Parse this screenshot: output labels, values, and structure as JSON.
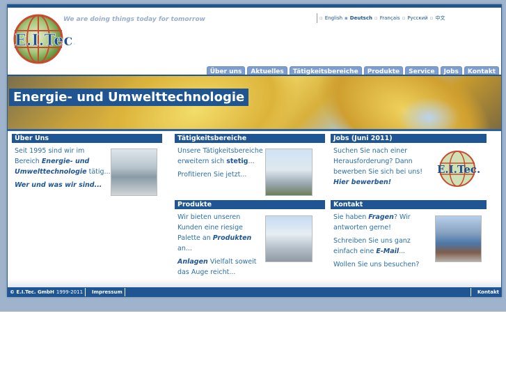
{
  "header": {
    "logo_text": "E.I.Tec.",
    "tagline": "We are doing things today for tomorrow",
    "languages": [
      {
        "label": "English",
        "current": false
      },
      {
        "label": "Deutsch",
        "current": true
      },
      {
        "label": "Français",
        "current": false
      },
      {
        "label": "Русский",
        "current": false
      },
      {
        "label": "中文",
        "current": false
      }
    ],
    "nav": [
      "Über uns",
      "Aktuelles",
      "Tätigkeitsbereiche",
      "Produkte",
      "Service",
      "Jobs",
      "Kontakt"
    ]
  },
  "hero": {
    "title": "Energie- und Umwelttechnologie"
  },
  "boxes": {
    "ueber_uns": {
      "title": "Über Uns",
      "text1_a": "Seit 1995 sind wir im Bereich ",
      "text1_link": "Energie- und Umwelttechnologie",
      "text1_b": " tätig...",
      "link": "Wer und was wir sind..."
    },
    "taetigkeit": {
      "title": "Tätigkeitsbereiche",
      "text1_a": "Unsere Tätigkeitsbereiche erweitern sich ",
      "text1_link": "stetig",
      "text1_b": "...",
      "text2": "Profitieren Sie jetzt..."
    },
    "jobs": {
      "title": "Jobs (Juni 2011)",
      "text1": "Suchen Sie nach einer Herausforderung? Dann bewerben Sie sich bei uns!",
      "link": "Hier bewerben!"
    },
    "produkte": {
      "title": "Produkte",
      "text1_a": "Wir bieten unseren Kunden eine riesige Palette an ",
      "text1_link": "Produkten",
      "text1_b": " an...",
      "text2_link": "Anlagen",
      "text2_b": " Vielfalt soweit das Auge reicht..."
    },
    "kontakt": {
      "title": "Kontakt",
      "text1_a": "Sie haben ",
      "text1_link": "Fragen",
      "text1_b": "? Wir antworten gerne!",
      "text2_a": "Schreiben Sie uns ganz einfach eine ",
      "text2_link": "E-Mail",
      "text2_b": "...",
      "text3": "Wollen Sie uns besuchen?"
    }
  },
  "footer": {
    "company": "© E.I.Tec. GmbH",
    "years": "1999-2011",
    "impressum": "Impressum",
    "kontakt": "Kontakt"
  },
  "colors": {
    "brand": "#1f5592",
    "nav_tab": "#7f9ed0",
    "text": "#2a6fa8"
  }
}
